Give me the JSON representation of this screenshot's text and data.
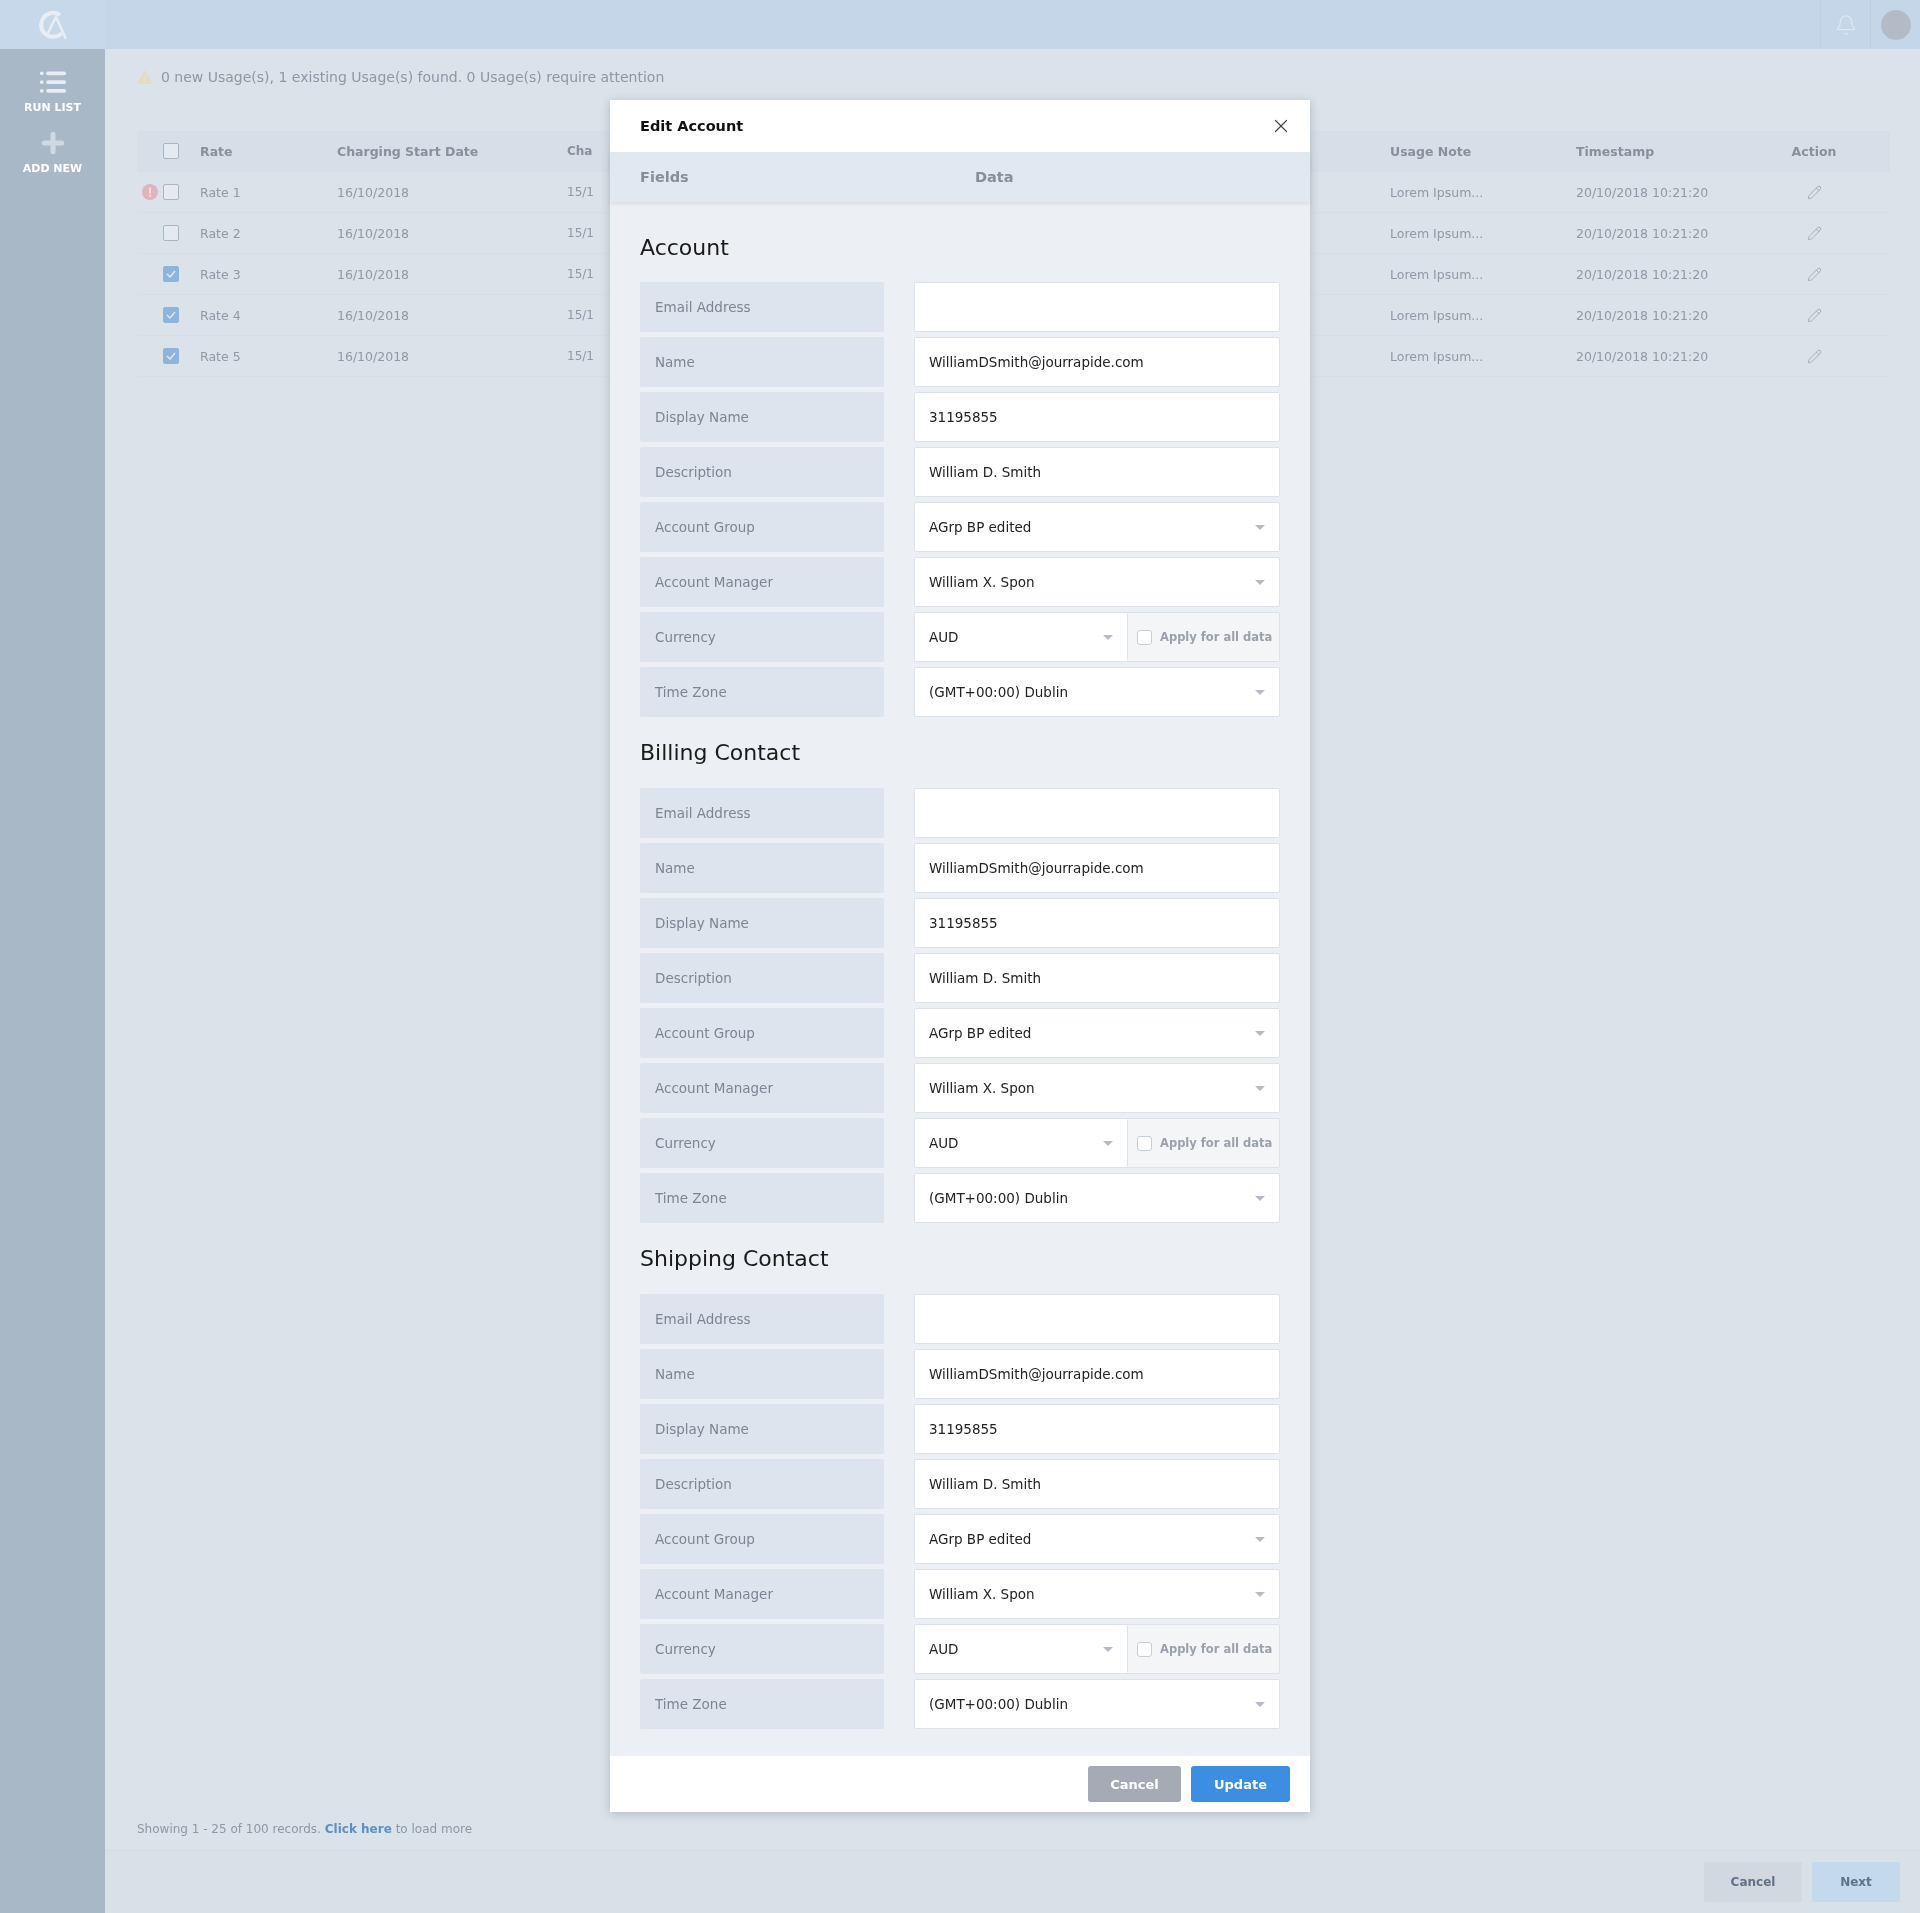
{
  "sidebar": {
    "items": [
      {
        "label": "RUN LIST",
        "kind": "list"
      },
      {
        "label": "ADD NEW",
        "kind": "add"
      }
    ]
  },
  "notice": "0 new Usage(s), 1 existing Usage(s) found. 0 Usage(s) require attention",
  "table": {
    "columns": [
      "Rate",
      "Charging Start Date",
      "Cha",
      "Usage Note",
      "Timestamp",
      "Action"
    ],
    "header_checked": false,
    "rows": [
      {
        "error": true,
        "checked": false,
        "cells": [
          "Rate 1",
          "16/10/2018",
          "15/1",
          "Lorem Ipsum...",
          "20/10/2018 10:21:20"
        ]
      },
      {
        "error": false,
        "checked": false,
        "cells": [
          "Rate 2",
          "16/10/2018",
          "15/1",
          "Lorem Ipsum...",
          "20/10/2018 10:21:20"
        ]
      },
      {
        "error": false,
        "checked": true,
        "cells": [
          "Rate 3",
          "16/10/2018",
          "15/1",
          "Lorem Ipsum...",
          "20/10/2018 10:21:20"
        ]
      },
      {
        "error": false,
        "checked": true,
        "cells": [
          "Rate 4",
          "16/10/2018",
          "15/1",
          "Lorem Ipsum...",
          "20/10/2018 10:21:20"
        ]
      },
      {
        "error": false,
        "checked": true,
        "cells": [
          "Rate 5",
          "16/10/2018",
          "15/1",
          "Lorem Ipsum...",
          "20/10/2018 10:21:20"
        ]
      }
    ]
  },
  "records_note": {
    "text": "Showing 1 - 25 of 100 records.",
    "link": "Click here",
    "rest": "to load more"
  },
  "footer_buttons": [
    {
      "label": "Cancel",
      "kind": "secondary"
    },
    {
      "label": "Next",
      "kind": "primary"
    }
  ],
  "modal": {
    "title": "Edit Account",
    "columns": [
      "Fields",
      "Data"
    ],
    "sections": [
      {
        "title": "Account",
        "rows": [
          {
            "label": "Email Address",
            "kind": "text"
          },
          {
            "label": "Name",
            "kind": "text",
            "value": "WilliamDSmith@jourrapide.com"
          },
          {
            "label": "Display Name",
            "kind": "text",
            "value": "31195855"
          },
          {
            "label": "Description",
            "kind": "text",
            "value": "William D. Smith"
          },
          {
            "label": "Account Group",
            "kind": "select",
            "value": "AGrp BP edited"
          },
          {
            "label": "Account Manager",
            "kind": "select",
            "value": "William X. Spon"
          },
          {
            "label": "Currency",
            "kind": "currency",
            "value": "AUD",
            "apply_label": "Apply for all data",
            "apply_checked": false
          },
          {
            "label": "Time Zone",
            "kind": "select",
            "value": "(GMT+00:00) Dublin"
          }
        ]
      },
      {
        "title": "Billing Contact",
        "rows": [
          {
            "label": "Email Address",
            "kind": "text"
          },
          {
            "label": "Name",
            "kind": "text",
            "value": "WilliamDSmith@jourrapide.com"
          },
          {
            "label": "Display Name",
            "kind": "text",
            "value": "31195855"
          },
          {
            "label": "Description",
            "kind": "text",
            "value": "William D. Smith"
          },
          {
            "label": "Account Group",
            "kind": "select",
            "value": "AGrp BP edited"
          },
          {
            "label": "Account Manager",
            "kind": "select",
            "value": "William X. Spon"
          },
          {
            "label": "Currency",
            "kind": "currency",
            "value": "AUD",
            "apply_label": "Apply for all data",
            "apply_checked": false
          },
          {
            "label": "Time Zone",
            "kind": "select",
            "value": "(GMT+00:00) Dublin"
          }
        ]
      },
      {
        "title": "Shipping Contact",
        "rows": [
          {
            "label": "Email Address",
            "kind": "text"
          },
          {
            "label": "Name",
            "kind": "text",
            "value": "WilliamDSmith@jourrapide.com"
          },
          {
            "label": "Display Name",
            "kind": "text",
            "value": "31195855"
          },
          {
            "label": "Description",
            "kind": "text",
            "value": "William D. Smith"
          },
          {
            "label": "Account Group",
            "kind": "select",
            "value": "AGrp BP edited"
          },
          {
            "label": "Account Manager",
            "kind": "select",
            "value": "William X. Spon"
          },
          {
            "label": "Currency",
            "kind": "currency",
            "value": "AUD",
            "apply_label": "Apply for all data",
            "apply_checked": false
          },
          {
            "label": "Time Zone",
            "kind": "select",
            "value": "(GMT+00:00) Dublin"
          }
        ]
      }
    ],
    "buttons": [
      {
        "label": "Cancel",
        "kind": "secondary"
      },
      {
        "label": "Update",
        "kind": "primary"
      }
    ]
  }
}
